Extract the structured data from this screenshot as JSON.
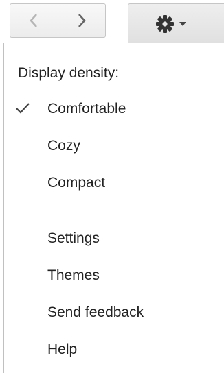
{
  "toolbar": {
    "prev_icon": "chevron-left-icon",
    "next_icon": "chevron-right-icon",
    "settings_icon": "gear-icon",
    "dropdown_icon": "caret-down-icon"
  },
  "menu": {
    "density_heading": "Display density:",
    "density_options": [
      {
        "label": "Comfortable",
        "checked": true
      },
      {
        "label": "Cozy",
        "checked": false
      },
      {
        "label": "Compact",
        "checked": false
      }
    ],
    "actions": [
      {
        "label": "Settings"
      },
      {
        "label": "Themes"
      },
      {
        "label": "Send feedback"
      },
      {
        "label": "Help"
      }
    ]
  }
}
